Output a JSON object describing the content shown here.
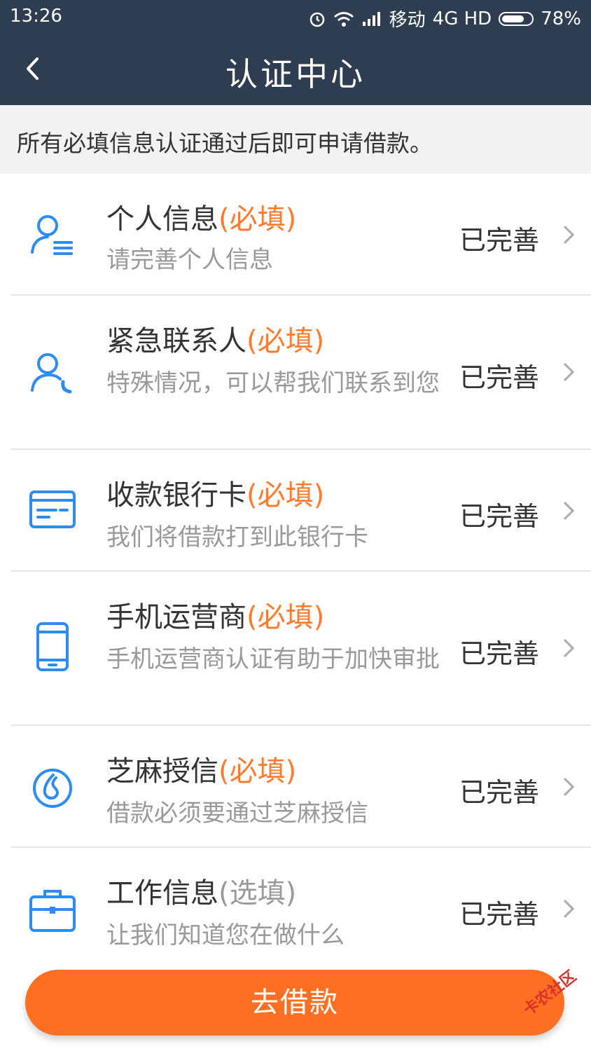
{
  "status_bar": {
    "time": "13:26",
    "carrier": "移动",
    "network": "4G HD",
    "battery": "78%",
    "battery_level": 0.78
  },
  "header": {
    "title": "认证中心",
    "back_icon": "chevron-left-icon"
  },
  "notice": "所有必填信息认证通过后即可申请借款。",
  "items": [
    {
      "title": "个人信息",
      "tag": "(必填)",
      "desc": "请完善个人信息",
      "status": "已完善",
      "icon": "user-list-icon"
    },
    {
      "title": "紧急联系人",
      "tag": "(必填)",
      "desc": "特殊情况，可以帮我们联系到您",
      "status": "已完善",
      "icon": "user-phone-icon"
    },
    {
      "title": "收款银行卡",
      "tag": "(必填)",
      "desc": "我们将借款打到此银行卡",
      "status": "已完善",
      "icon": "bank-card-icon"
    },
    {
      "title": "手机运营商",
      "tag": "(必填)",
      "desc": "手机运营商认证有助于加快审批",
      "status": "已完善",
      "icon": "mobile-phone-icon"
    },
    {
      "title": "芝麻授信",
      "tag": "(必填)",
      "desc": "借款必须要通过芝麻授信",
      "status": "已完善",
      "icon": "sesame-credit-icon"
    },
    {
      "title": "工作信息",
      "tag": "(选填)",
      "desc": "让我们知道您在做什么",
      "status": "已完善",
      "icon": "briefcase-icon"
    }
  ],
  "button": {
    "label": "去借款"
  },
  "watermark": "卡农社区",
  "colors": {
    "header": "#2e3d4f",
    "accent": "#ff6f21",
    "icon": "#2d8cf0",
    "required": "#ff7a2c"
  }
}
